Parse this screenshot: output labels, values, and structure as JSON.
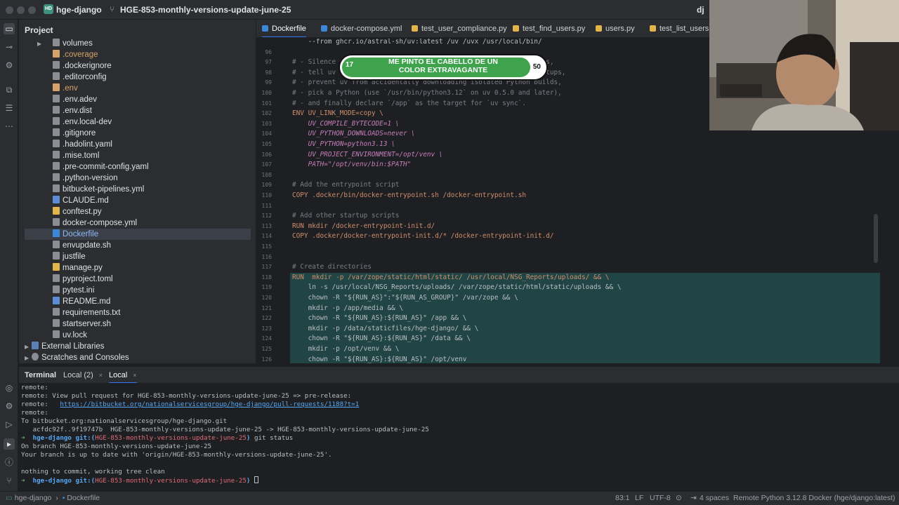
{
  "titlebar": {
    "project_badge": "HD",
    "project_name": "hge-django",
    "branch": "HGE-853-monthly-versions-update-june-25",
    "right_label": "dj"
  },
  "project_panel": {
    "title": "Project",
    "items": [
      {
        "label": "volumes",
        "kind": "folder"
      },
      {
        "label": ".coverage",
        "kind": "orange"
      },
      {
        "label": ".dockerignore",
        "kind": "plain"
      },
      {
        "label": ".editorconfig",
        "kind": "plain"
      },
      {
        "label": ".env",
        "kind": "orange"
      },
      {
        "label": ".env.adev",
        "kind": "plain"
      },
      {
        "label": ".env.dist",
        "kind": "plain"
      },
      {
        "label": ".env.local-dev",
        "kind": "plain"
      },
      {
        "label": ".gitignore",
        "kind": "plain"
      },
      {
        "label": ".hadolint.yaml",
        "kind": "plain"
      },
      {
        "label": ".mise.toml",
        "kind": "plain"
      },
      {
        "label": ".pre-commit-config.yaml",
        "kind": "plain"
      },
      {
        "label": ".python-version",
        "kind": "plain"
      },
      {
        "label": "bitbucket-pipelines.yml",
        "kind": "plain"
      },
      {
        "label": "CLAUDE.md",
        "kind": "md"
      },
      {
        "label": "conftest.py",
        "kind": "py"
      },
      {
        "label": "docker-compose.yml",
        "kind": "plain"
      },
      {
        "label": "Dockerfile",
        "kind": "docker"
      },
      {
        "label": "envupdate.sh",
        "kind": "plain"
      },
      {
        "label": "justfile",
        "kind": "plain"
      },
      {
        "label": "manage.py",
        "kind": "py"
      },
      {
        "label": "pyproject.toml",
        "kind": "plain"
      },
      {
        "label": "pytest.ini",
        "kind": "plain"
      },
      {
        "label": "README.md",
        "kind": "md"
      },
      {
        "label": "requirements.txt",
        "kind": "plain"
      },
      {
        "label": "startserver.sh",
        "kind": "plain"
      },
      {
        "label": "uv.lock",
        "kind": "plain"
      }
    ],
    "external_libraries": "External Libraries",
    "scratches": "Scratches and Consoles"
  },
  "tabs": [
    "Dockerfile",
    "docker-compose.yml",
    "test_user_compliance.py",
    "test_find_users.py",
    "users.py",
    "test_list_users.py"
  ],
  "editor": {
    "lines": [
      {
        "n": "",
        "t": "    --from ghcr.io/astral-sh/uv:latest /uv /uvx /usr/local/bin/",
        "c": "c-plain"
      },
      {
        "n": "96",
        "t": "",
        "c": "c-plain"
      },
      {
        "n": "97",
        "t": "# - Silence uv complaining about not being able to use hard links,",
        "c": "c-com"
      },
      {
        "n": "98",
        "t": "# - tell uv to byte-compile packages for faster application startups,",
        "c": "c-com"
      },
      {
        "n": "99",
        "t": "# - prevent uv from accidentally downloading isolated Python builds,",
        "c": "c-com"
      },
      {
        "n": "100",
        "t": "# - pick a Python (use `/usr/bin/python3.12` on uv 0.5.0 and later),",
        "c": "c-com"
      },
      {
        "n": "101",
        "t": "# - and finally declare `/app` as the target for `uv sync`.",
        "c": "c-com"
      },
      {
        "n": "102",
        "t": "ENV UV_LINK_MODE=copy \\",
        "c": "env"
      },
      {
        "n": "103",
        "t": "    UV_COMPILE_BYTECODE=1 \\",
        "c": "envv"
      },
      {
        "n": "104",
        "t": "    UV_PYTHON_DOWNLOADS=never \\",
        "c": "envv"
      },
      {
        "n": "105",
        "t": "    UV_PYTHON=python3.13 \\",
        "c": "envv"
      },
      {
        "n": "106",
        "t": "    UV_PROJECT_ENVIRONMENT=/opt/venv \\",
        "c": "envv"
      },
      {
        "n": "107",
        "t": "    PATH=\"/opt/venv/bin:$PATH\"",
        "c": "envp"
      },
      {
        "n": "108",
        "t": "",
        "c": "c-plain"
      },
      {
        "n": "109",
        "t": "# Add the entrypoint script",
        "c": "c-com"
      },
      {
        "n": "110",
        "t": "COPY .docker/bin/docker-entrypoint.sh /docker-entrypoint.sh",
        "c": "kwline"
      },
      {
        "n": "111",
        "t": "",
        "c": "c-plain"
      },
      {
        "n": "112",
        "t": "# Add other startup scripts",
        "c": "c-com"
      },
      {
        "n": "113",
        "t": "RUN mkdir /docker-entrypoint-init.d/",
        "c": "kwline"
      },
      {
        "n": "114",
        "t": "COPY .docker/docker-entrypoint-init.d/* /docker-entrypoint-init.d/",
        "c": "kwline"
      },
      {
        "n": "115",
        "t": "",
        "c": "c-plain"
      },
      {
        "n": "116",
        "t": "",
        "c": "c-plain"
      },
      {
        "n": "117",
        "t": "# Create directories",
        "c": "c-com"
      },
      {
        "n": "118",
        "t": "RUN  mkdir -p /var/zope/static/html/static/ /usr/local/NSG_Reports/uploads/ && \\",
        "c": "kwline",
        "hl": true
      },
      {
        "n": "119",
        "t": "    ln -s /usr/local/NSG_Reports/uploads/ /var/zope/static/html/static/uploads && \\",
        "c": "c-plain",
        "hl": true
      },
      {
        "n": "120",
        "t": "    chown -R \"${RUN_AS}\":\"${RUN_AS_GROUP}\" /var/zope && \\",
        "c": "c-plain",
        "hl": true
      },
      {
        "n": "121",
        "t": "    mkdir -p /app/media && \\",
        "c": "c-plain",
        "hl": true
      },
      {
        "n": "122",
        "t": "    chown -R \"${RUN_AS}:${RUN_AS}\" /app && \\",
        "c": "c-plain",
        "hl": true
      },
      {
        "n": "123",
        "t": "    mkdir -p /data/staticfiles/hge-django/ && \\",
        "c": "c-plain",
        "hl": true
      },
      {
        "n": "124",
        "t": "    chown -R \"${RUN_AS}:${RUN_AS}\" /data && \\",
        "c": "c-plain",
        "hl": true
      },
      {
        "n": "125",
        "t": "    mkdir -p /opt/venv && \\",
        "c": "c-plain",
        "hl": true
      },
      {
        "n": "126",
        "t": "    chown -R \"${RUN_AS}:${RUN_AS}\" /opt/venv",
        "c": "c-plain",
        "hl": true
      }
    ]
  },
  "banner": {
    "start": "17",
    "text_line1": "ME PINTO EL CABELLO DE UN",
    "text_line2": "COLOR EXTRAVAGANTE",
    "end": "50"
  },
  "terminal": {
    "tabs": [
      "Terminal",
      "Local (2)",
      "Local"
    ],
    "lines": [
      "remote:",
      "remote: View pull request for HGE-853-monthly-versions-update-june-25 => pre-release:",
      "remote:   https://bitbucket.org/nationalservicesgroup/hge-django/pull-requests/1188?t=1",
      "remote:",
      "To bitbucket.org:nationalservicesgroup/hge-django.git",
      "   acfdc92f..9f19747b  HGE-853-monthly-versions-update-june-25 -> HGE-853-monthly-versions-update-june-25",
      "",
      "On branch HGE-853-monthly-versions-update-june-25",
      "Your branch is up to date with 'origin/HGE-853-monthly-versions-update-june-25'.",
      "",
      "nothing to commit, working tree clean",
      ""
    ],
    "prompt_dir": "hge-django",
    "prompt_git": "git:(",
    "prompt_branch": "HGE-853-monthly-versions-update-june-25",
    "prompt_close": ")",
    "prompt_cmd": " git status"
  },
  "statusbar": {
    "crumb1": "hge-django",
    "crumb2": "Dockerfile",
    "position": "83:1",
    "line_sep": "LF",
    "encoding": "UTF-8",
    "indent": "4 spaces",
    "interpreter": "Remote Python 3.12.8 Docker (hge/django:latest)"
  }
}
